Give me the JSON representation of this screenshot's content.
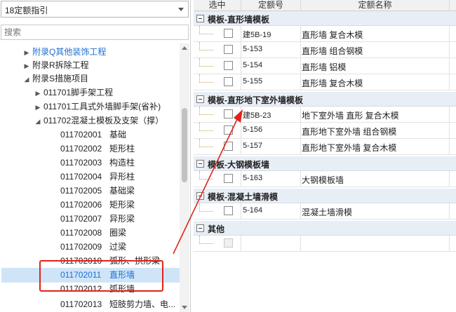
{
  "left_panel": {
    "dropdown_value": "18定额指引",
    "search_placeholder": "搜索",
    "tree": [
      {
        "toggle": "▶",
        "label": "附录Q其他装饰工程"
      },
      {
        "toggle": "▶",
        "label": "附录R拆除工程"
      },
      {
        "toggle": "◢",
        "label": "附录S措施项目"
      },
      {
        "toggle": "▶",
        "label": "011701脚手架工程"
      },
      {
        "toggle": "▶",
        "label": "011701工具式外墙脚手架(省补)"
      },
      {
        "toggle": "◢",
        "label": "011702混凝土模板及支架（撑）"
      },
      {
        "code": "011702001",
        "name": "基础"
      },
      {
        "code": "011702002",
        "name": "矩形柱"
      },
      {
        "code": "011702003",
        "name": "构造柱"
      },
      {
        "code": "011702004",
        "name": "异形柱"
      },
      {
        "code": "011702005",
        "name": "基础梁"
      },
      {
        "code": "011702006",
        "name": "矩形梁"
      },
      {
        "code": "011702007",
        "name": "异形梁"
      },
      {
        "code": "011702008",
        "name": "圈梁"
      },
      {
        "code": "011702009",
        "name": "过梁"
      },
      {
        "code": "011702010",
        "name": "弧形、拱形梁"
      },
      {
        "code": "011702011",
        "name": "直形墙"
      },
      {
        "code": "011702012",
        "name": "弧形墙"
      },
      {
        "code": "011702013",
        "name": "短肢剪力墙、电..."
      }
    ]
  },
  "right_panel": {
    "headers": [
      "选中",
      "定额号",
      "定额名称"
    ],
    "groups": [
      {
        "title": "模板-直形墙模板",
        "rows": [
          {
            "code": "建5B-19",
            "name": "直形墙 复合木模"
          },
          {
            "code": "5-153",
            "name": "直形墙 组合钢模"
          },
          {
            "code": "5-154",
            "name": "直形墙 铝模"
          },
          {
            "code": "5-155",
            "name": "直形墙 复合木模"
          }
        ]
      },
      {
        "title": "模板-直形地下室外墙模板",
        "rows": [
          {
            "code": "建5B-23",
            "name": "地下室外墙 直形 复合木模"
          },
          {
            "code": "5-156",
            "name": "直形地下室外墙 组合钢模"
          },
          {
            "code": "5-157",
            "name": "直形地下室外墙 复合木模"
          }
        ]
      },
      {
        "title": "模板-大钢模板墙",
        "rows": [
          {
            "code": "5-163",
            "name": "大钢模板墙"
          }
        ]
      },
      {
        "title": "模板-混凝土墙滑模",
        "rows": [
          {
            "code": "5-164",
            "name": "混凝土墙滑模"
          }
        ]
      },
      {
        "title": "其他",
        "rows": [
          {
            "code": "",
            "name": ""
          }
        ]
      }
    ]
  },
  "colors": {
    "selection": "#cfe5f7",
    "annotation": "#e0231b",
    "group_bg": "#e8eef5"
  }
}
